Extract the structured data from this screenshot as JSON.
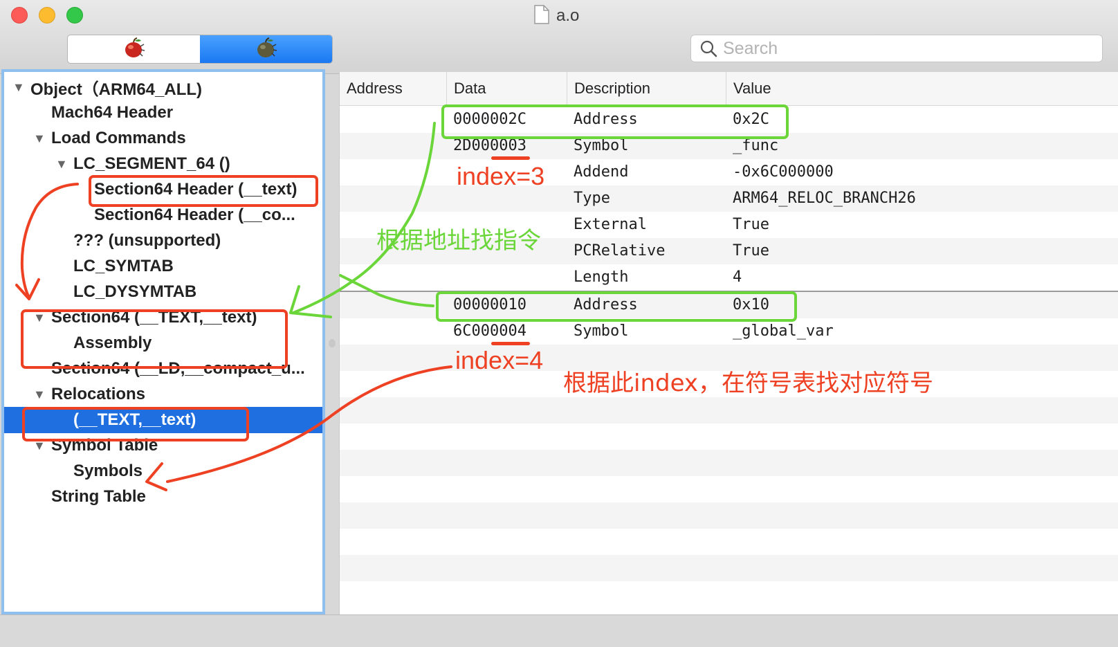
{
  "window": {
    "title": "a.o"
  },
  "toolbar": {
    "search": {
      "placeholder": "Search",
      "value": ""
    }
  },
  "tree": [
    {
      "label": "Object（ARM64_ALL)",
      "expanded": true
    },
    {
      "label": "Mach64 Header"
    },
    {
      "label": "Load Commands",
      "expanded": true
    },
    {
      "label": "LC_SEGMENT_64 ()",
      "expanded": true
    },
    {
      "label": "Section64 Header (__text)"
    },
    {
      "label": "Section64 Header (__co..."
    },
    {
      "label": "??? (unsupported)"
    },
    {
      "label": "LC_SYMTAB"
    },
    {
      "label": "LC_DYSYMTAB"
    },
    {
      "label": "Section64 (__TEXT,__text)",
      "expanded": true
    },
    {
      "label": "Assembly"
    },
    {
      "label": "Section64 (__LD,__compact_u..."
    },
    {
      "label": "Relocations",
      "expanded": true
    },
    {
      "label": "(__TEXT,__text)",
      "selected": true
    },
    {
      "label": "Symbol Table",
      "expanded": true
    },
    {
      "label": "Symbols"
    },
    {
      "label": "String Table"
    }
  ],
  "table": {
    "columns": [
      "Address",
      "Data",
      "Description",
      "Value"
    ],
    "rows": [
      {
        "data": "0000002C",
        "description": "Address",
        "value": "0x2C"
      },
      {
        "data": "2D000003",
        "description": "Symbol",
        "value": "_func"
      },
      {
        "data": "",
        "description": "Addend",
        "value": "-0x6C000000"
      },
      {
        "data": "",
        "description": "Type",
        "value": "ARM64_RELOC_BRANCH26"
      },
      {
        "data": "",
        "description": "External",
        "value": "True"
      },
      {
        "data": "",
        "description": "PCRelative",
        "value": "True"
      },
      {
        "data": "",
        "description": "Length",
        "value": "4"
      },
      {
        "data": "00000010",
        "description": "Address",
        "value": "0x10"
      },
      {
        "data": "6C000004",
        "description": "Symbol",
        "value": "_global_var"
      }
    ]
  },
  "annotations": {
    "index3": "index=3",
    "index4": "index=4",
    "find_instruction": "根据地址找指令",
    "find_symbol": "根据此index，在符号表找对应符号"
  },
  "colors": {
    "annotation_red": "#ee4022",
    "annotation_green": "#6bd63a",
    "selection": "#1f6fe0"
  },
  "icons": [
    "file-icon",
    "apple-icon",
    "search-icon",
    "disclosure-triangle-icon"
  ]
}
